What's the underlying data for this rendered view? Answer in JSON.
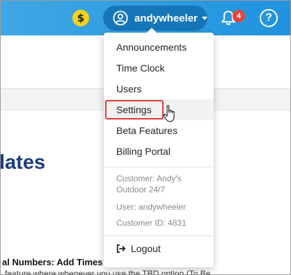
{
  "topbar": {
    "coin_symbol": "$",
    "username": "andywheeler",
    "notifications_count": "4",
    "help_symbol": "?"
  },
  "page": {
    "heading": "lates",
    "subheading": "al Numbers: Add Times",
    "body_text": "feature where whenever you use the TBD option (To Be"
  },
  "menu": {
    "items": [
      {
        "label": "Announcements"
      },
      {
        "label": "Time Clock"
      },
      {
        "label": "Users"
      },
      {
        "label": "Settings"
      },
      {
        "label": "Beta Features"
      },
      {
        "label": "Billing Portal"
      }
    ],
    "info": {
      "customer": "Customer: Andy's Outdoor 24/7",
      "user": "User: andywheeler",
      "customer_id": "Customer ID: 4831"
    },
    "logout_label": "Logout"
  },
  "colors": {
    "topbar": "#1f93e0",
    "user_pill": "#1676b8",
    "heading": "#1e3a82",
    "highlight_box": "#e03c3c",
    "badge": "#e2463d",
    "coin": "#f5d31b"
  }
}
